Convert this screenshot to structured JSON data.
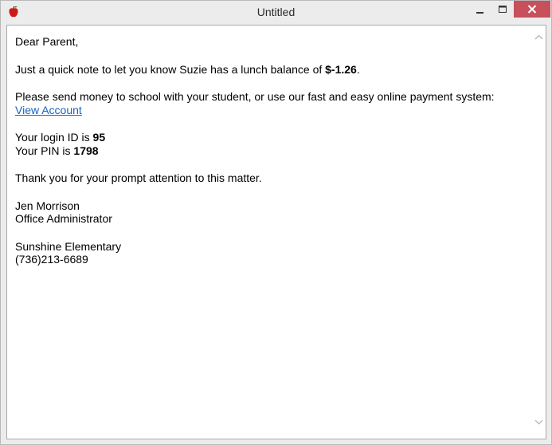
{
  "window": {
    "title": "Untitled",
    "icon": "apple-icon",
    "colors": {
      "close_button": "#c7505a",
      "link": "#1565c0"
    }
  },
  "letter": {
    "greeting": "Dear Parent,",
    "balance_prefix": "Just a quick note to let you know Suzie has a lunch balance of ",
    "balance_amount": "$-1.26",
    "balance_suffix": ".",
    "payment_text": "Please send money to school with your student, or use our fast and easy online payment system:",
    "link_text": "View Account",
    "login_prefix": "Your login ID is ",
    "login_id": "95",
    "pin_prefix": "Your PIN is ",
    "pin": "1798",
    "thanks": "Thank you for your prompt attention to this matter.",
    "signer_name": "Jen Morrison",
    "signer_title": "Office Administrator",
    "school_name": "Sunshine Elementary",
    "school_phone": "(736)213-6689"
  }
}
